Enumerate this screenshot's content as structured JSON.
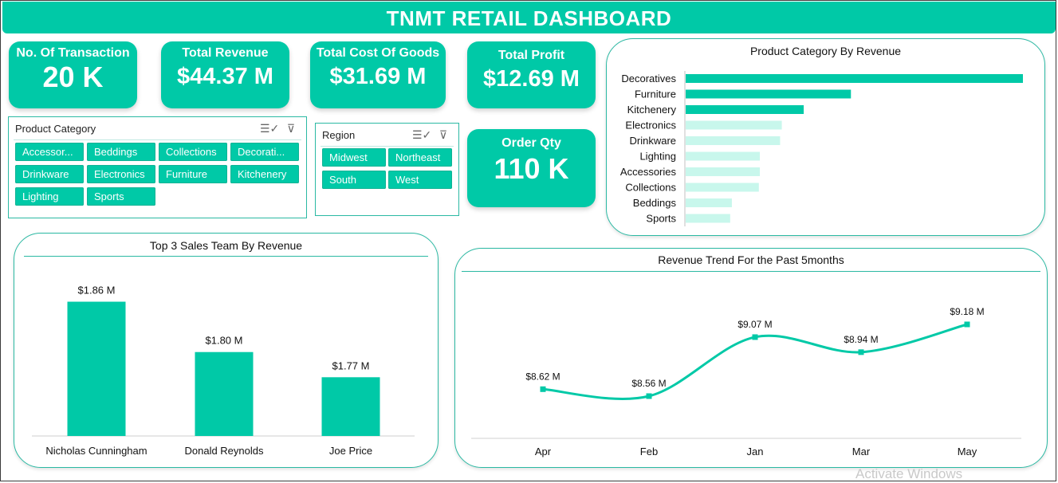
{
  "dashboard": {
    "title": "TNMT RETAIL DASHBOARD"
  },
  "kpis": {
    "transactions": {
      "label": "No. Of Transaction",
      "value": "20 K"
    },
    "revenue": {
      "label": "Total Revenue",
      "value": "$44.37 M"
    },
    "cost": {
      "label": "Total Cost Of Goods",
      "value": "$31.69 M"
    },
    "profit": {
      "label": "Total Profit",
      "value": "$12.69 M"
    },
    "order_qty": {
      "label": "Order Qty",
      "value": "110 K"
    }
  },
  "category_slicer": {
    "header": "Product Category",
    "items": [
      "Accessor...",
      "Beddings",
      "Collections",
      "Decorati...",
      "Drinkware",
      "Electronics",
      "Furniture",
      "Kitchenery",
      "Lighting",
      "Sports"
    ]
  },
  "region_slicer": {
    "header": "Region",
    "items": [
      "Midwest",
      "Northeast",
      "South",
      "West"
    ]
  },
  "colors": {
    "accent": "#00c9a7",
    "accent_light": "#c8f7ec",
    "border": "#2bb9a3"
  },
  "icons": {
    "multi_select": "multi-select-icon",
    "clear_filter": "clear-filter-icon"
  },
  "watermark": "Activate Windows",
  "chart_data": [
    {
      "type": "bar",
      "orientation": "horizontal",
      "title": "Product Category By Revenue",
      "categories": [
        "Decoratives",
        "Furniture",
        "Kitchenery",
        "Electronics",
        "Drinkware",
        "Lighting",
        "Accessories",
        "Collections",
        "Beddings",
        "Sports"
      ],
      "values": [
        10.0,
        4.9,
        3.5,
        2.85,
        2.8,
        2.2,
        2.2,
        2.17,
        1.37,
        1.32
      ],
      "highlighted_count": 3
    },
    {
      "type": "bar",
      "title": "Top 3 Sales Team By Revenue",
      "categories": [
        "Nicholas Cunningham",
        "Donald Reynolds",
        "Joe Price"
      ],
      "values": [
        1.86,
        1.8,
        1.77
      ],
      "data_labels": [
        "$1.86 M",
        "$1.80 M",
        "$1.77 M"
      ],
      "ylim": [
        1.7,
        1.87
      ]
    },
    {
      "type": "line",
      "title": "Revenue Trend For the Past 5months",
      "categories": [
        "Apr",
        "Feb",
        "Jan",
        "Mar",
        "May"
      ],
      "values": [
        8.62,
        8.56,
        9.07,
        8.94,
        9.18
      ],
      "data_labels": [
        "$8.62 M",
        "$8.56 M",
        "$9.07 M",
        "$8.94 M",
        "$9.18 M"
      ],
      "smooth": true
    }
  ]
}
